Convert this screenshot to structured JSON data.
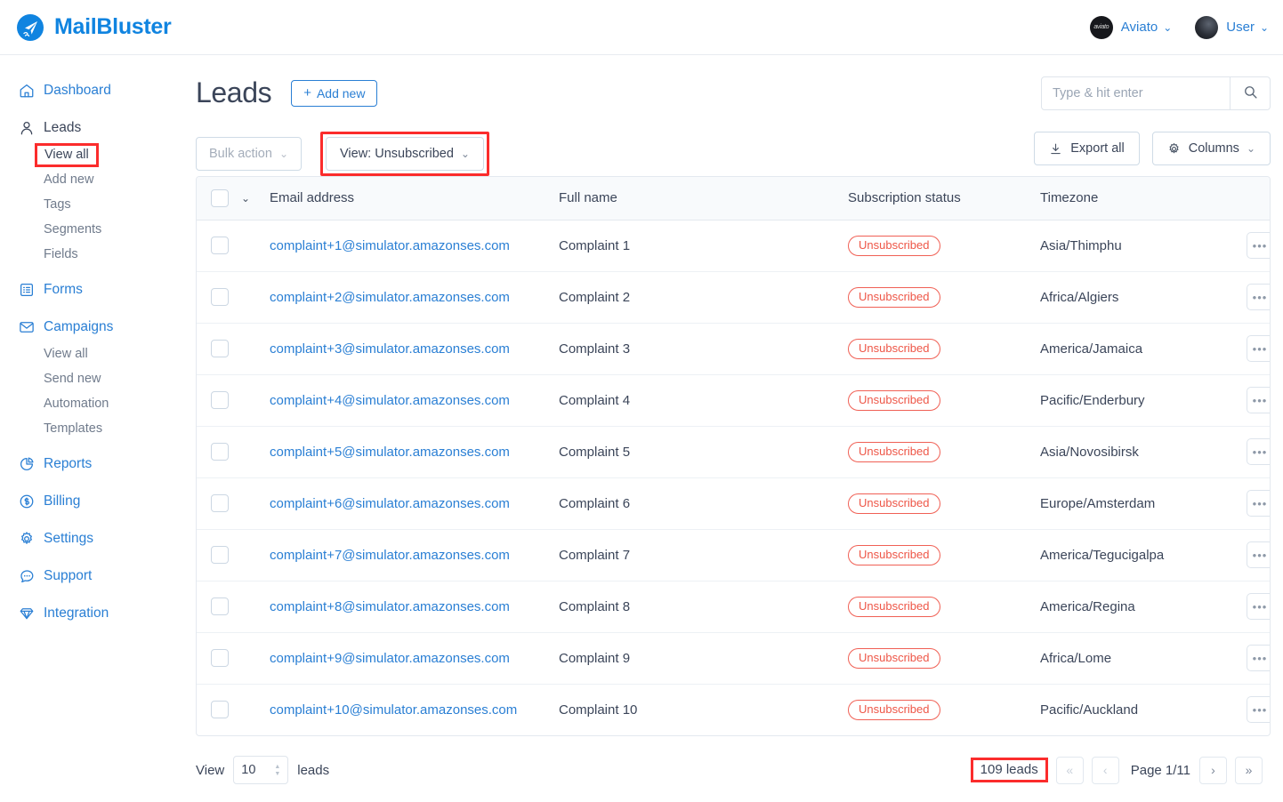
{
  "brand": {
    "name": "MailBluster",
    "logo_icon": "paper-plane-logo",
    "color": "#1084e0"
  },
  "topbar": {
    "accounts": [
      {
        "label": "Aviato",
        "avatar_icon": "aviato-avatar",
        "caret": "⌄"
      },
      {
        "label": "User",
        "avatar_icon": "user-avatar",
        "caret": "⌄"
      }
    ]
  },
  "sidebar": {
    "items": [
      {
        "label": "Dashboard",
        "icon": "home-icon",
        "type": "main",
        "active": false
      },
      {
        "label": "Leads",
        "icon": "person-icon",
        "type": "main",
        "active": true
      },
      {
        "label": "View all",
        "type": "sub",
        "current": true
      },
      {
        "label": "Add new",
        "type": "sub",
        "current": false
      },
      {
        "label": "Tags",
        "type": "sub",
        "current": false
      },
      {
        "label": "Segments",
        "type": "sub",
        "current": false
      },
      {
        "label": "Fields",
        "type": "sub",
        "current": false
      },
      {
        "label": "Forms",
        "icon": "form-icon",
        "type": "main",
        "active": false
      },
      {
        "label": "Campaigns",
        "icon": "envelope-icon",
        "type": "main",
        "active": false
      },
      {
        "label": "View all",
        "type": "sub",
        "current": false
      },
      {
        "label": "Send new",
        "type": "sub",
        "current": false
      },
      {
        "label": "Automation",
        "type": "sub",
        "current": false
      },
      {
        "label": "Templates",
        "type": "sub",
        "current": false
      },
      {
        "label": "Reports",
        "icon": "pie-chart-icon",
        "type": "main",
        "active": false
      },
      {
        "label": "Billing",
        "icon": "dollar-circle-icon",
        "type": "main",
        "active": false
      },
      {
        "label": "Settings",
        "icon": "gear-icon",
        "type": "main",
        "active": false
      },
      {
        "label": "Support",
        "icon": "chat-bubble-icon",
        "type": "main",
        "active": false
      },
      {
        "label": "Integration",
        "icon": "diamond-icon",
        "type": "main",
        "active": false
      }
    ]
  },
  "page": {
    "title": "Leads",
    "add_new_label": "Add new",
    "add_new_plus": "+"
  },
  "search": {
    "placeholder": "Type & hit enter",
    "value": "",
    "icon": "search-icon"
  },
  "toolbar": {
    "bulk_action_label": "Bulk action",
    "bulk_action_caret": "⌄",
    "bulk_action_disabled": true,
    "view_label": "View: Unsubscribed",
    "view_caret": "⌄",
    "view_highlighted": true,
    "export_label": "Export all",
    "export_icon": "download-icon",
    "columns_label": "Columns",
    "columns_icon": "gear-icon",
    "columns_caret": "⌄"
  },
  "table": {
    "columns": [
      "Email address",
      "Full name",
      "Subscription status",
      "Timezone"
    ],
    "header_caret": "⌄",
    "rows": [
      {
        "email": "complaint+1@simulator.amazonses.com",
        "name": "Complaint 1",
        "status": "Unsubscribed",
        "timezone": "Asia/Thimphu"
      },
      {
        "email": "complaint+2@simulator.amazonses.com",
        "name": "Complaint 2",
        "status": "Unsubscribed",
        "timezone": "Africa/Algiers"
      },
      {
        "email": "complaint+3@simulator.amazonses.com",
        "name": "Complaint 3",
        "status": "Unsubscribed",
        "timezone": "America/Jamaica"
      },
      {
        "email": "complaint+4@simulator.amazonses.com",
        "name": "Complaint 4",
        "status": "Unsubscribed",
        "timezone": "Pacific/Enderbury"
      },
      {
        "email": "complaint+5@simulator.amazonses.com",
        "name": "Complaint 5",
        "status": "Unsubscribed",
        "timezone": "Asia/Novosibirsk"
      },
      {
        "email": "complaint+6@simulator.amazonses.com",
        "name": "Complaint 6",
        "status": "Unsubscribed",
        "timezone": "Europe/Amsterdam"
      },
      {
        "email": "complaint+7@simulator.amazonses.com",
        "name": "Complaint 7",
        "status": "Unsubscribed",
        "timezone": "America/Tegucigalpa"
      },
      {
        "email": "complaint+8@simulator.amazonses.com",
        "name": "Complaint 8",
        "status": "Unsubscribed",
        "timezone": "America/Regina"
      },
      {
        "email": "complaint+9@simulator.amazonses.com",
        "name": "Complaint 9",
        "status": "Unsubscribed",
        "timezone": "Africa/Lome"
      },
      {
        "email": "complaint+10@simulator.amazonses.com",
        "name": "Complaint 10",
        "status": "Unsubscribed",
        "timezone": "Pacific/Auckland"
      }
    ],
    "row_action_label": "•••"
  },
  "footer": {
    "view_prefix": "View",
    "per_page": "10",
    "view_suffix": "leads",
    "total_label": "109 leads",
    "total_highlighted": true,
    "first_label": "«",
    "prev_label": "‹",
    "page_label": "Page 1/11",
    "next_label": "›",
    "last_label": "»",
    "first_disabled": true,
    "prev_disabled": true
  },
  "colors": {
    "accent": "#2a7fd4",
    "brand": "#1084e0",
    "unsubscribed": "#ee5647",
    "highlight_box": "#fb2c2c"
  }
}
